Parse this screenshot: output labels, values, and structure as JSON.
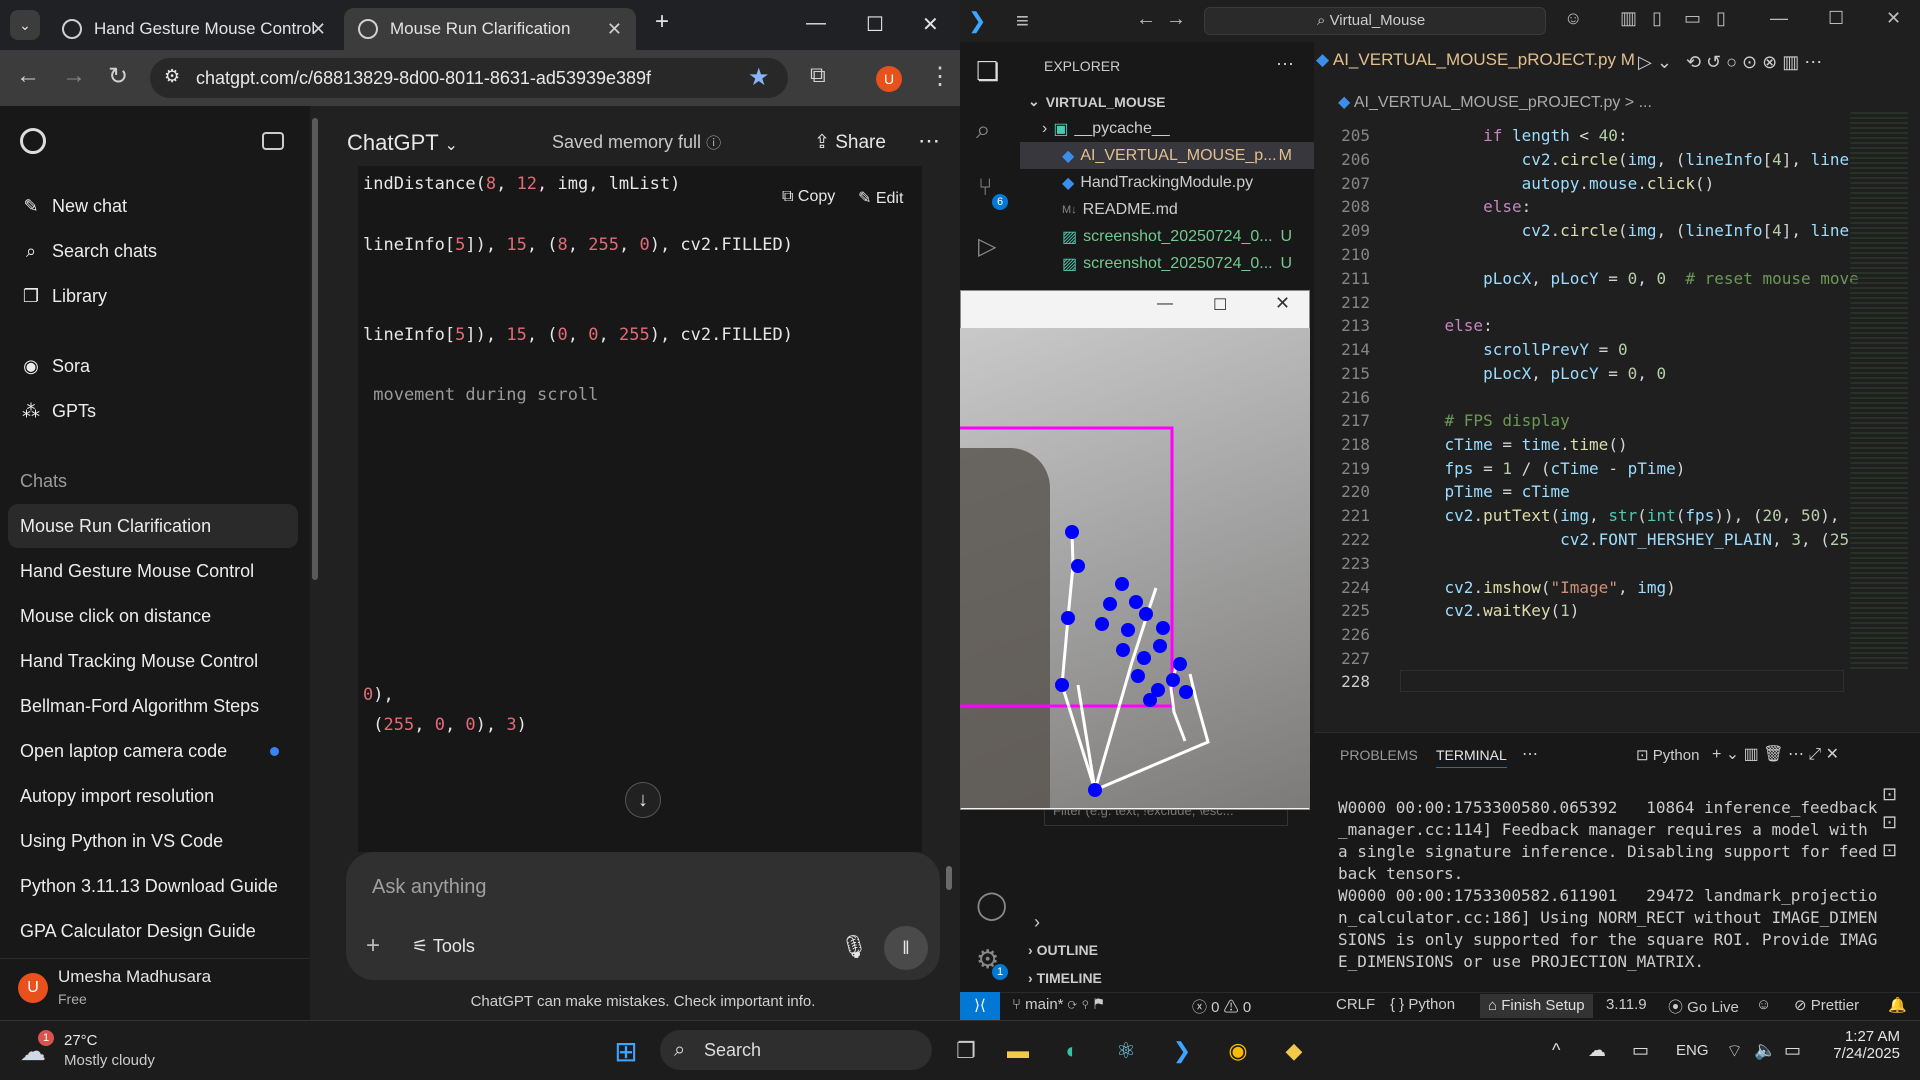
{
  "chrome": {
    "tabs": [
      {
        "label": "Hand Gesture Mouse Control",
        "active": false
      },
      {
        "label": "Mouse Run Clarification",
        "active": true
      }
    ],
    "url": "chatgpt.com/c/68813829-8d00-8011-8631-ad53939e389f",
    "profile_initial": "U"
  },
  "chatgpt": {
    "sidebar": {
      "nav": [
        "New chat",
        "Search chats",
        "Library"
      ],
      "sora": "Sora",
      "gpts": "GPTs",
      "chats_heading": "Chats",
      "chats": [
        "Mouse Run Clarification",
        "Hand Gesture Mouse Control",
        "Mouse click on distance",
        "Hand Tracking Mouse Control",
        "Bellman-Ford Algorithm Steps",
        "Open laptop camera code",
        "Autopy import resolution",
        "Using Python in VS Code",
        "Python 3.11.13 Download Guide",
        "GPA Calculator Design Guide"
      ],
      "user": {
        "name": "Umesha Madhusara",
        "plan": "Free",
        "initial": "U"
      }
    },
    "header": {
      "title": "ChatGPT",
      "memory": "Saved memory full",
      "share": "Share"
    },
    "code_actions": {
      "copy": "Copy",
      "edit": "Edit"
    },
    "code_lines": [
      "indDistance(8, 12, img, lmList)",
      "lineInfo[5]), 15, (8, 255, 0), cv2.FILLED)",
      "lineInfo[5]), 15, (0, 0, 255), cv2.FILLED)",
      " movement during scroll",
      "0),",
      " (255, 0, 0), 3)"
    ],
    "composer": {
      "placeholder": "Ask anything",
      "tools": "Tools"
    },
    "disclaimer": "ChatGPT can make mistakes. Check important info."
  },
  "vscode": {
    "search": "Virtual_Mouse",
    "explorer_title": "EXPLORER",
    "folder": "VIRTUAL_MOUSE",
    "files": [
      {
        "name": "__pycache__",
        "badge": ""
      },
      {
        "name": "AI_VERTUAL_MOUSE_p...",
        "badge": "M"
      },
      {
        "name": "HandTrackingModule.py",
        "badge": ""
      },
      {
        "name": "README.md",
        "badge": ""
      },
      {
        "name": "screenshot_20250724_0...",
        "badge": "U"
      },
      {
        "name": "screenshot_20250724_0...",
        "badge": "U"
      }
    ],
    "filter_placeholder": "Filter (e.g. text, !exclude, \\esc...",
    "outline": "OUTLINE",
    "timeline": "TIMELINE",
    "editor_tab": "AI_VERTUAL_MOUSE_pROJECT.py",
    "editor_tab_badge": "M",
    "breadcrumb": "AI_VERTUAL_MOUSE_pROJECT.py > ...",
    "source_control_badge": "6",
    "settings_badge": "1",
    "line_numbers": [
      "205",
      "206",
      "207",
      "208",
      "209",
      "210",
      "211",
      "212",
      "213",
      "214",
      "215",
      "216",
      "217",
      "218",
      "219",
      "220",
      "221",
      "222",
      "223",
      "224",
      "225",
      "226",
      "227",
      "228"
    ],
    "panel": {
      "tabs": [
        "PROBLEMS",
        "TERMINAL"
      ],
      "shell": "Python",
      "terminal_lines": [
        "W0000 00:00:1753300580.065392   10864 inference_feedback",
        "_manager.cc:114] Feedback manager requires a model with",
        "a single signature inference. Disabling support for feed",
        "back tensors.",
        "W0000 00:00:1753300582.611901   29472 landmark_projectio",
        "n_calculator.cc:186] Using NORM_RECT without IMAGE_DIMEN",
        "SIONS is only supported for the square ROI. Provide IMAG",
        "E_DIMENSIONS or use PROJECTION_MATRIX."
      ]
    },
    "status": {
      "branch": "main*",
      "errors": "0",
      "warnings": "0",
      "eol": "CRLF",
      "language": "Python",
      "finish_setup": "Finish Setup",
      "version": "3.11.9",
      "golive": "Go Live",
      "prettier": "Prettier"
    }
  },
  "taskbar": {
    "weather_temp": "27°C",
    "weather_desc": "Mostly cloudy",
    "weather_badge": "1",
    "search": "Search",
    "lang": "ENG",
    "time": "1:27 AM",
    "date": "7/24/2025"
  },
  "colors": {
    "accent_blue": "#0078d4",
    "magenta_box": "#ff00ff",
    "landmark": "#0000ff",
    "profile": "#e8501c"
  }
}
